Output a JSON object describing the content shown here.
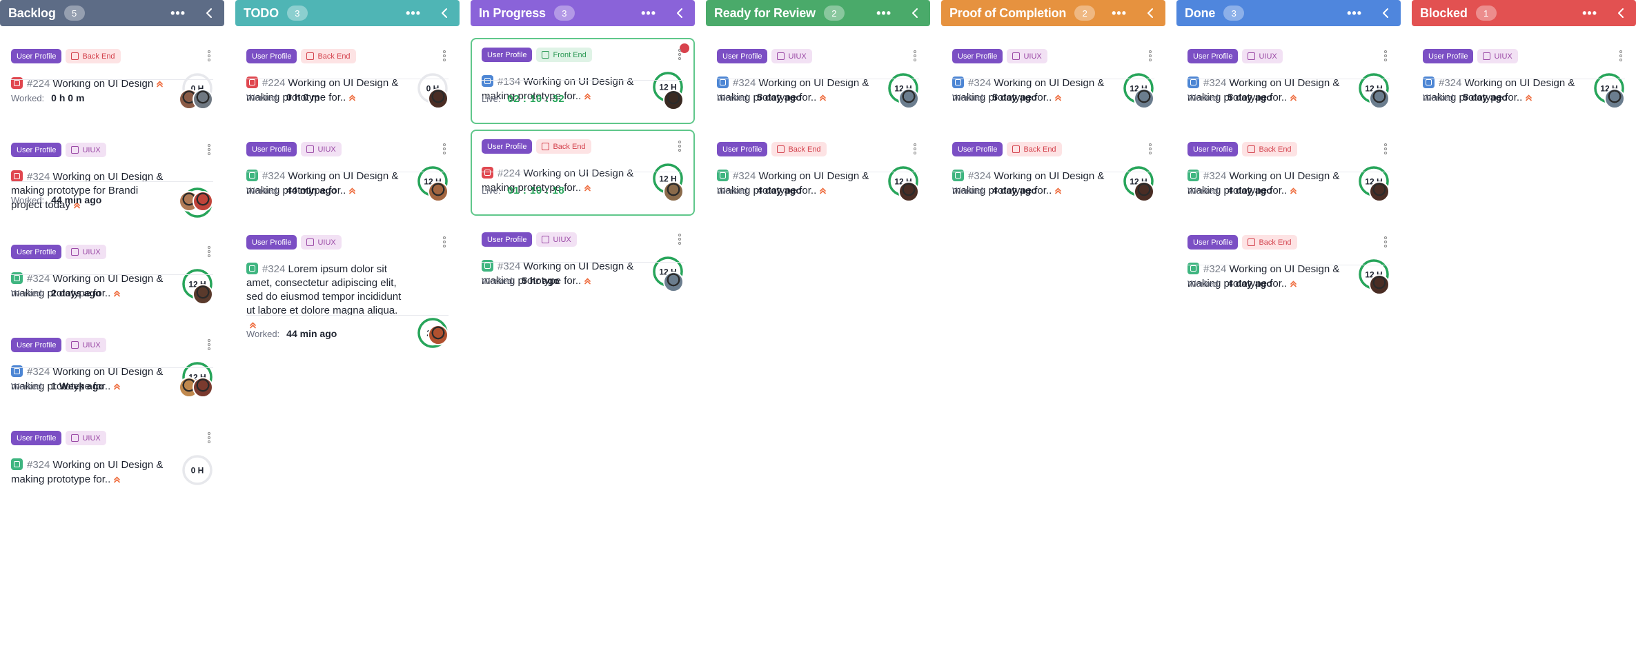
{
  "colors": {
    "backlog": "#5d6c86",
    "todo": "#4fb5b5",
    "in_progress": "#8a63d9",
    "ready_for_review": "#4aaa6a",
    "proof_of_completion": "#e6923f",
    "done": "#4f86dd",
    "blocked": "#e25151",
    "ring": "#27a55a",
    "ring_track": "#e7e8ec"
  },
  "columns": [
    {
      "id": "backlog",
      "title": "Backlog",
      "count": "5",
      "color": "#5d6c86",
      "cards": [
        {
          "tags": [
            "profile",
            "backend"
          ],
          "type": "bug",
          "num": "#224",
          "text": "Working on UI Design",
          "ring": "0 H",
          "progress": 0,
          "footer_label": "Worked:",
          "footer_value": "0 h 0 m",
          "avatars": [
            "#8a5a45",
            "#6f7882"
          ],
          "height": 128
        },
        {
          "tags": [
            "profile",
            "uiux"
          ],
          "type": "bug",
          "num": "#324",
          "text": "Working on UI Design & making prototype for Brandi project today",
          "ring": "12 H",
          "progress": 1,
          "footer_label": "Worked:",
          "footer_value": "44 min ago",
          "avatars": [
            "#b07a55",
            "#c0443a"
          ],
          "height": 140
        },
        {
          "tags": [
            "profile",
            "uiux"
          ],
          "type": "story",
          "num": "#324",
          "text": "Working on UI Design & making prototype for..",
          "ring": "12 H",
          "progress": 1,
          "footer_label": "Worked:",
          "footer_value": "2 days ago",
          "avatars": [
            "#5a3a2c"
          ],
          "height": 127
        },
        {
          "tags": [
            "profile",
            "uiux"
          ],
          "type": "task",
          "num": "#324",
          "text": "Working on UI Design & making prototype for..",
          "ring": "12 H",
          "progress": 1,
          "footer_label": "Worked:",
          "footer_value": "1 Week ago",
          "avatars": [
            "#c0894e",
            "#7a3a2e"
          ],
          "height": 127
        },
        {
          "tags": [
            "profile",
            "uiux"
          ],
          "type": "story",
          "num": "#324",
          "text": "Working on UI Design & making prototype for..",
          "ring": "0 H",
          "progress": 0,
          "footer_label": "",
          "footer_value": "",
          "avatars": [],
          "height": 100
        }
      ]
    },
    {
      "id": "todo",
      "title": "TODO",
      "count": "3",
      "color": "#4fb5b5",
      "cards": [
        {
          "tags": [
            "profile",
            "backend"
          ],
          "type": "bug",
          "num": "#224",
          "text": "Working on UI Design & making prototype for..",
          "ring": "0 H",
          "progress": 0,
          "footer_label": "Worked:",
          "footer_value": "0 h 0 m",
          "avatars": [
            "#4a2d24"
          ],
          "height": 127
        },
        {
          "tags": [
            "profile",
            "uiux"
          ],
          "type": "story",
          "num": "#324",
          "text": "Working on UI Design & making prototype for..",
          "ring": "12 H",
          "progress": 1,
          "footer_label": "Worked:",
          "footer_value": "44 min ago",
          "avatars": [
            "#a36640"
          ],
          "height": 127
        },
        {
          "tags": [
            "profile",
            "uiux"
          ],
          "type": "story",
          "num": "#324",
          "text": "Lorem ipsum dolor sit amet, consectetur adipiscing elit, sed do eiusmod tempor incididunt ut labore et dolore magna aliqua.",
          "ring": "2 h",
          "progress": 1,
          "footer_label": "Worked:",
          "footer_value": "44 min ago",
          "avatars": [
            "#b0512f"
          ],
          "height": 200
        }
      ]
    },
    {
      "id": "in_progress",
      "title": "In Progress",
      "count": "3",
      "color": "#8a63d9",
      "cards": [
        {
          "tags": [
            "profile",
            "frontend"
          ],
          "type": "task",
          "num": "#134",
          "text": "Working on UI Design & making prototype for..",
          "ring": "12 H",
          "progress": 1,
          "footer_label": "Live:",
          "footer_value": "02 : 10 : 32",
          "live": true,
          "active": true,
          "dot": true,
          "avatars": [
            "#3a2a22"
          ],
          "height": 125
        },
        {
          "tags": [
            "profile",
            "backend"
          ],
          "type": "bug",
          "num": "#224",
          "text": "Working on UI Design & making prototype for..",
          "ring": "12 H",
          "progress": 1,
          "footer_label": "Live:",
          "footer_value": "01 : 10 : 18",
          "live": true,
          "active": true,
          "avatars": [
            "#8a6a4a"
          ],
          "height": 125
        },
        {
          "tags": [
            "profile",
            "uiux"
          ],
          "type": "story",
          "num": "#324",
          "text": "Working on UI Design & making prototype for..",
          "ring": "12 H",
          "progress": 1,
          "footer_label": "Worked:",
          "footer_value": "5 hr ago",
          "avatars": [
            "#6b7d8e"
          ],
          "height": 127
        }
      ]
    },
    {
      "id": "ready_for_review",
      "title": "Ready for Review",
      "count": "2",
      "color": "#4aaa6a",
      "cards": [
        {
          "tags": [
            "profile",
            "uiux"
          ],
          "type": "task",
          "num": "#324",
          "text": "Working on UI Design & making prototype for..",
          "ring": "12 H",
          "progress": 1,
          "footer_label": "Worked:",
          "footer_value": "5 day ago",
          "avatars": [
            "#6b7d8e"
          ],
          "height": 127
        },
        {
          "tags": [
            "profile",
            "backend"
          ],
          "type": "story",
          "num": "#324",
          "text": "Working on UI Design & making prototype for..",
          "ring": "12 H",
          "progress": 1,
          "footer_label": "Worked:",
          "footer_value": "4 day ago",
          "avatars": [
            "#4a2d24"
          ],
          "height": 127
        }
      ]
    },
    {
      "id": "proof_of_completion",
      "title": "Proof of Completion",
      "count": "2",
      "color": "#e6923f",
      "cards": [
        {
          "tags": [
            "profile",
            "uiux"
          ],
          "type": "task",
          "num": "#324",
          "text": "Working on UI Design & making prototype for..",
          "ring": "12 H",
          "progress": 1,
          "footer_label": "Worked:",
          "footer_value": "5 day ago",
          "avatars": [
            "#6b7d8e"
          ],
          "height": 127
        },
        {
          "tags": [
            "profile",
            "backend"
          ],
          "type": "story",
          "num": "#324",
          "text": "Working on UI Design & making prototype for..",
          "ring": "12 H",
          "progress": 1,
          "footer_label": "Worked:",
          "footer_value": "4 day ago",
          "avatars": [
            "#4a2d24"
          ],
          "height": 127
        }
      ]
    },
    {
      "id": "done",
      "title": "Done",
      "count": "3",
      "color": "#4f86dd",
      "cards": [
        {
          "tags": [
            "profile",
            "uiux"
          ],
          "type": "task",
          "num": "#324",
          "text": "Working on UI Design & making prototype for..",
          "ring": "12 H",
          "progress": 1,
          "footer_label": "Worked:",
          "footer_value": "5 day ago",
          "avatars": [
            "#6b7d8e"
          ],
          "height": 127
        },
        {
          "tags": [
            "profile",
            "backend"
          ],
          "type": "story",
          "num": "#324",
          "text": "Working on UI Design & making prototype for..",
          "ring": "12 H",
          "progress": 1,
          "footer_label": "Worked:",
          "footer_value": "4 day ago",
          "avatars": [
            "#4a2d24"
          ],
          "height": 127
        },
        {
          "tags": [
            "profile",
            "backend"
          ],
          "type": "story",
          "num": "#324",
          "text": "Working on UI Design & making prototype for..",
          "ring": "12 H",
          "progress": 1,
          "footer_label": "Worked:",
          "footer_value": "4 day ago",
          "avatars": [
            "#4a2d24"
          ],
          "height": 127
        }
      ]
    },
    {
      "id": "blocked",
      "title": "Blocked",
      "count": "1",
      "color": "#e25151",
      "cards": [
        {
          "tags": [
            "profile",
            "uiux"
          ],
          "type": "task",
          "num": "#324",
          "text": "Working on UI Design & making prototype for..",
          "ring": "12 H",
          "progress": 1,
          "footer_label": "Worked:",
          "footer_value": "5 day ago",
          "avatars": [
            "#6b7d8e"
          ],
          "height": 127
        }
      ]
    }
  ],
  "tag_labels": {
    "profile": "User Profile",
    "backend": "Back End",
    "uiux": "UIUX",
    "frontend": "Front End"
  },
  "icons": {
    "more": "more-horizontal-icon",
    "collapse": "chevron-left-icon",
    "kebab": "more-vertical-icon",
    "priority": "double-chevron-up-icon"
  }
}
